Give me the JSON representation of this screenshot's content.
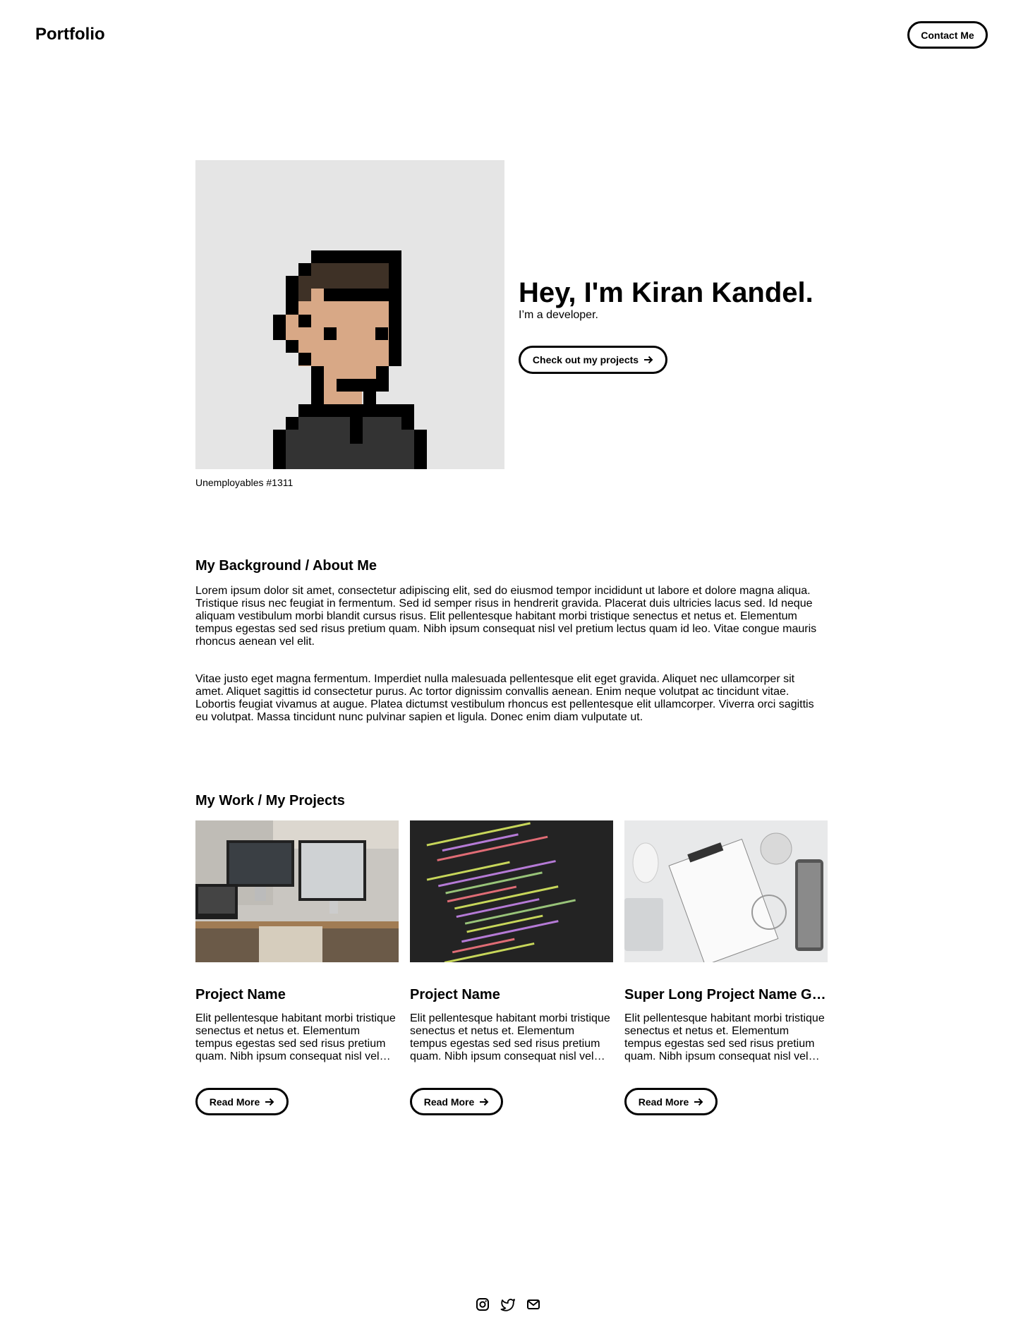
{
  "header": {
    "brand": "Portfolio",
    "contact_label": "Contact Me"
  },
  "hero": {
    "image_caption": "Unemployables #1311",
    "title": "Hey, I'm Kiran Kandel.",
    "subtitle": "I’m a developer.",
    "projects_button_label": "Check out my projects",
    "projects_button_icon": "arrow-right-icon"
  },
  "about": {
    "heading": "My Background / About Me",
    "paragraphs": [
      "Lorem ipsum dolor sit amet, consectetur adipiscing elit, sed do eiusmod tempor incididunt ut labore et dolore magna aliqua. Tristique risus nec feugiat in fermentum. Sed id semper risus in hendrerit gravida. Placerat duis ultricies lacus sed. Id neque aliquam vestibulum morbi blandit cursus risus. Elit pellentesque habitant morbi tristique senectus et netus et. Elementum tempus egestas sed sed risus pretium quam. Nibh ipsum consequat nisl vel pretium lectus quam id leo. Vitae congue mauris rhoncus aenean vel elit.",
      "Vitae justo eget magna fermentum. Imperdiet nulla malesuada pellentesque elit eget gravida. Aliquet nec ullamcorper sit amet. Aliquet sagittis id consectetur purus. Ac tortor dignissim convallis aenean. Enim neque volutpat ac tincidunt vitae. Lobortis feugiat vivamus at augue. Platea dictumst vestibulum rhoncus est pellentesque elit ullamcorper. Viverra orci sagittis eu volutpat. Massa tincidunt nunc pulvinar sapien et ligula. Donec enim diam vulputate ut."
    ]
  },
  "work": {
    "heading": "My Work / My Projects",
    "projects": [
      {
        "title": "Project Name",
        "description": "Elit pellentesque habitant morbi tristique senectus et netus et. Elementum tempus egestas sed sed risus pretium quam. Nibh ipsum consequat nisl vel pretium lectus quam id leo.",
        "button_label": "Read More"
      },
      {
        "title": "Project Name",
        "description": "Elit pellentesque habitant morbi tristique senectus et netus et. Elementum tempus egestas sed sed risus pretium quam. Nibh ipsum consequat nisl vel pretium lectus quam id leo.",
        "button_label": "Read More"
      },
      {
        "title": "Super Long Project Name Goes Here",
        "description": "Elit pellentesque habitant morbi tristique senectus et netus et. Elementum tempus egestas sed sed risus pretium quam. Nibh ipsum consequat nisl vel pretium lectus quam id leo.",
        "button_label": "Read More"
      }
    ]
  },
  "footer": {
    "social_icons": [
      "instagram-icon",
      "twitter-icon",
      "email-icon"
    ]
  },
  "colors": {
    "text": "#000000",
    "background": "#ffffff",
    "avatar_bg": "#e5e5e5",
    "avatar_skin": "#d8a886",
    "avatar_hair": "#3e3126",
    "avatar_shirt": "#333333"
  }
}
